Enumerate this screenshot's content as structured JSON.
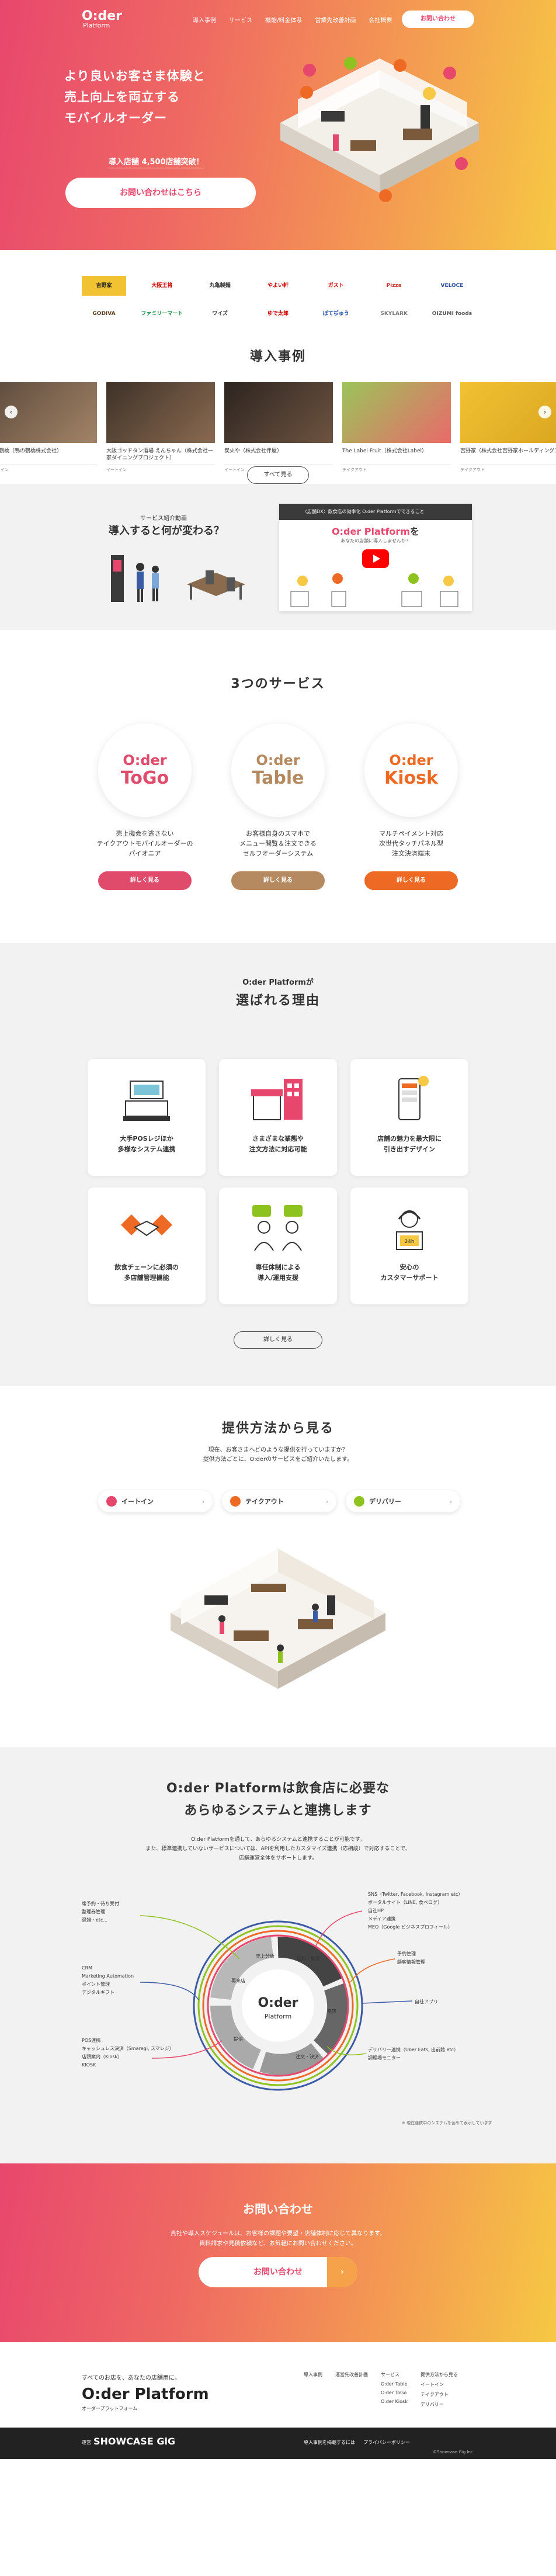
{
  "nav": {
    "logo_main": "O:der",
    "logo_sub": "Platform",
    "links": [
      "導入事例",
      "サービス",
      "機能/料金体系",
      "営業先改善計画",
      "会社概要"
    ],
    "cta": "お問い合わせ"
  },
  "hero": {
    "copy_line1": "より良いお客さま体験と",
    "copy_line2": "売上向上を両立する",
    "copy_line3": "モバイルオーダー",
    "badge": "導入店舗 4,500店舗突破！",
    "button": "お問い合わせはこちら"
  },
  "logos": {
    "row1": [
      "吉野家",
      "大阪王将",
      "丸亀製麺",
      "やよい軒",
      "ガスト",
      "Pizza",
      "VELOCE"
    ],
    "row2": [
      "GODIVA",
      "ファミリーマート",
      "ワイズ",
      "ゆで太郎",
      "ぼてぢゅう",
      "SKYLARK",
      "OIZUMI foods"
    ]
  },
  "cases": {
    "title": "導入事例",
    "items": [
      {
        "title": "鴨の鶴橋（鴨の鶴橋株式会社）",
        "tag": "イートイン"
      },
      {
        "title": "大阪ゴッドタン酒場 えんちゃん（株式会社一家ダイニングプロジェクト）",
        "tag": "イートイン"
      },
      {
        "title": "炭火や（株式会社伴屋）",
        "tag": "イートイン"
      },
      {
        "title": "The Label Fruit（株式会社Label）",
        "tag": "テイクアウト"
      },
      {
        "title": "吉野家（株式会社吉野家ホールディングス）",
        "tag": "テイクアウト"
      }
    ],
    "more": "すべて見る"
  },
  "video": {
    "sub": "サービス紹介動画",
    "title": "導入すると何が変わる？",
    "bar": "〈店舗DX〉飲食店の効率化 O:der Platformでできること",
    "head_logo": "O:der Platform",
    "head_text": "を",
    "sub2": "あなたの店舗に導入しませんか？"
  },
  "services": {
    "title": "3つのサービス",
    "items": [
      {
        "a": "O:der",
        "b": "ToGo",
        "desc": [
          "売上機会を逃さない",
          "テイクアウトモバイルオーダーの",
          "パイオニア"
        ],
        "btn": "詳しく見る",
        "color": "#e04a6b"
      },
      {
        "a": "O:der",
        "b": "Table",
        "desc": [
          "お客様自身のスマホで",
          "メニュー閲覧＆注文できる",
          "セルフオーダーシステム"
        ],
        "btn": "詳しく見る",
        "color": "#b58a61"
      },
      {
        "a": "O:der",
        "b": "Kiosk",
        "desc": [
          "マルチペイメント対応",
          "次世代タッチパネル型",
          "注文決済端末"
        ],
        "btn": "詳しく見る",
        "color": "#ee6a24"
      }
    ]
  },
  "reasons": {
    "sub": "O:der Platformが",
    "title": "選ばれる理由",
    "items": [
      [
        "大手POSレジほか",
        "多様なシステム連携"
      ],
      [
        "さまざまな業態や",
        "注文方法に対応可能"
      ],
      [
        "店舗の魅力を最大限に",
        "引き出すデザイン"
      ],
      [
        "飲食チェーンに必須の",
        "多店舗管理機能"
      ],
      [
        "専任体制による",
        "導入/運用支援"
      ],
      [
        "安心の",
        "カスタマーサポート"
      ]
    ],
    "icon_24h": "24h",
    "more": "詳しく見る"
  },
  "methods": {
    "title": "提供方法から見る",
    "desc_line1": "現在、お客さまへどのような提供を行っていますか？",
    "desc_line2": "提供方法ごとに、O:derのサービスをご紹介いたします。",
    "tabs": [
      {
        "label": "イートイン",
        "color": "#e8476d"
      },
      {
        "label": "テイクアウト",
        "color": "#ee6a24"
      },
      {
        "label": "デリバリー",
        "color": "#8dc21f"
      }
    ]
  },
  "integration": {
    "title_line1": "O:der Platformは飲食店に必要な",
    "title_line2": "あらゆるシステムと連携します",
    "desc_line1": "O:der Platformを通して、あらゆるシステムと連携することが可能です。",
    "desc_line2": "また、標準連携していないサービスについては、APIを利用したカスタマイズ連携（応相談）で対応することで、",
    "desc_line3": "店舗運営全体をサポートします。",
    "center_main": "O:der",
    "center_sub": "Platform",
    "ring_labels": [
      "認知・集客",
      "来店",
      "注文・決済",
      "提供",
      "再来店",
      "売上分析"
    ],
    "left_top": [
      "席予約・待ち受付",
      "整理券管理",
      "混雑・etc..."
    ],
    "left_mid": [
      "CRM",
      "Marketing Automation",
      "ポイント管理",
      "デジタルギフト"
    ],
    "left_bot": [
      "POS連携",
      "キャッシュレス決済（Smaregi, スマレジ）",
      "店頭案内（Kiosk）",
      "KIOSK"
    ],
    "right_top": [
      "SNS（Twitter, Facebook, Instagram etc）",
      "ポータルサイト（LINE, 食べログ）",
      "自社HP",
      "メディア連携",
      "MEO（Google ビジネスプロフィール）"
    ],
    "right_mid": [
      "予約管理",
      "顧客情報管理"
    ],
    "right_mid2": [
      "自社アプリ"
    ],
    "right_bot": [
      "デリバリー連携（Uber Eats, 出前館 etc）",
      "調理場モニター"
    ],
    "note": "※ 現在連携中のシステムを含めて表示しています"
  },
  "contact": {
    "title": "お問い合わせ",
    "desc_line1": "貴社や導入スケジュールは、お客様の課題や要望・店舗体制に応じて異なります。",
    "desc_line2": "資料請求や見積依頼など、お気軽にお問い合わせください。",
    "button": "お問い合わせ",
    "arrow": "›"
  },
  "footer": {
    "tagline": "すべてのお店を、あなたの店舗用に。",
    "logo": "O:der Platform",
    "logo_sub": "オーダープラットフォーム",
    "col1": [
      "導入事例"
    ],
    "col2": [
      "運営先改善計画"
    ],
    "col3": [
      "サービス",
      "O:der Table",
      "O:der ToGo",
      "O:der Kiosk"
    ],
    "col4": [
      "提供方法から見る",
      "イートイン",
      "テイクアウト",
      "デリバリー"
    ],
    "operator": "運営",
    "brand": "SHOWCASE GiG",
    "bottom_links": [
      "導入事例を掲載するには",
      "プライバシーポリシー"
    ],
    "copyright": "©Showcase Gig Inc."
  }
}
